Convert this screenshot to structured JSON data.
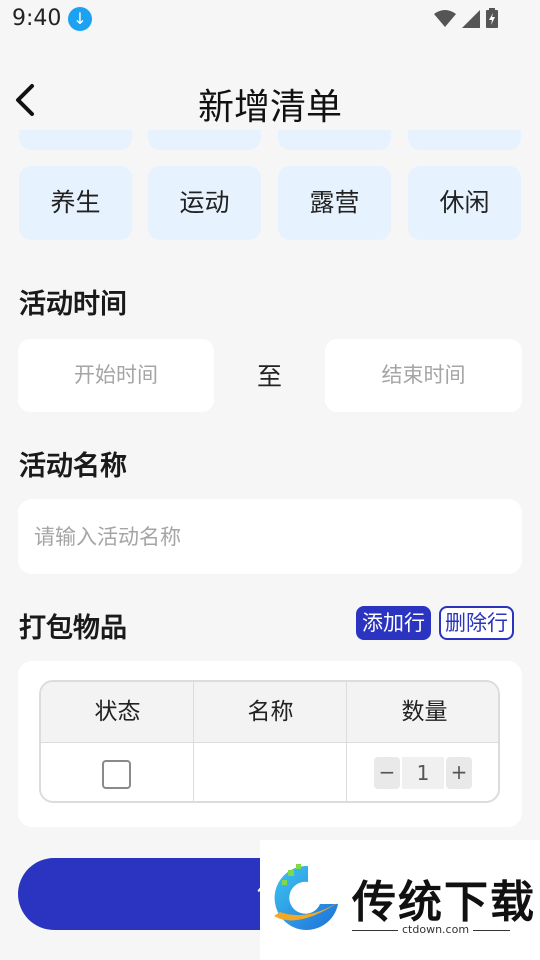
{
  "status_bar": {
    "time": "9:40"
  },
  "header": {
    "title": "新增清单"
  },
  "categories": [
    "养生",
    "运动",
    "露营",
    "休闲"
  ],
  "activity_time": {
    "section_title": "活动时间",
    "start_placeholder": "开始时间",
    "separator": "至",
    "end_placeholder": "结束时间"
  },
  "activity_name": {
    "section_title": "活动名称",
    "placeholder": "请输入活动名称",
    "value": ""
  },
  "pack_items": {
    "section_title": "打包物品",
    "add_row_label": "添加行",
    "delete_row_label": "删除行",
    "columns": [
      "状态",
      "名称",
      "数量"
    ],
    "rows": [
      {
        "checked": false,
        "name": "",
        "quantity": "1"
      }
    ],
    "minus_symbol": "−",
    "plus_symbol": "+"
  },
  "save_button": {
    "label": "保"
  },
  "watermark": {
    "text": "传统下载",
    "url": "ctdown.com"
  }
}
